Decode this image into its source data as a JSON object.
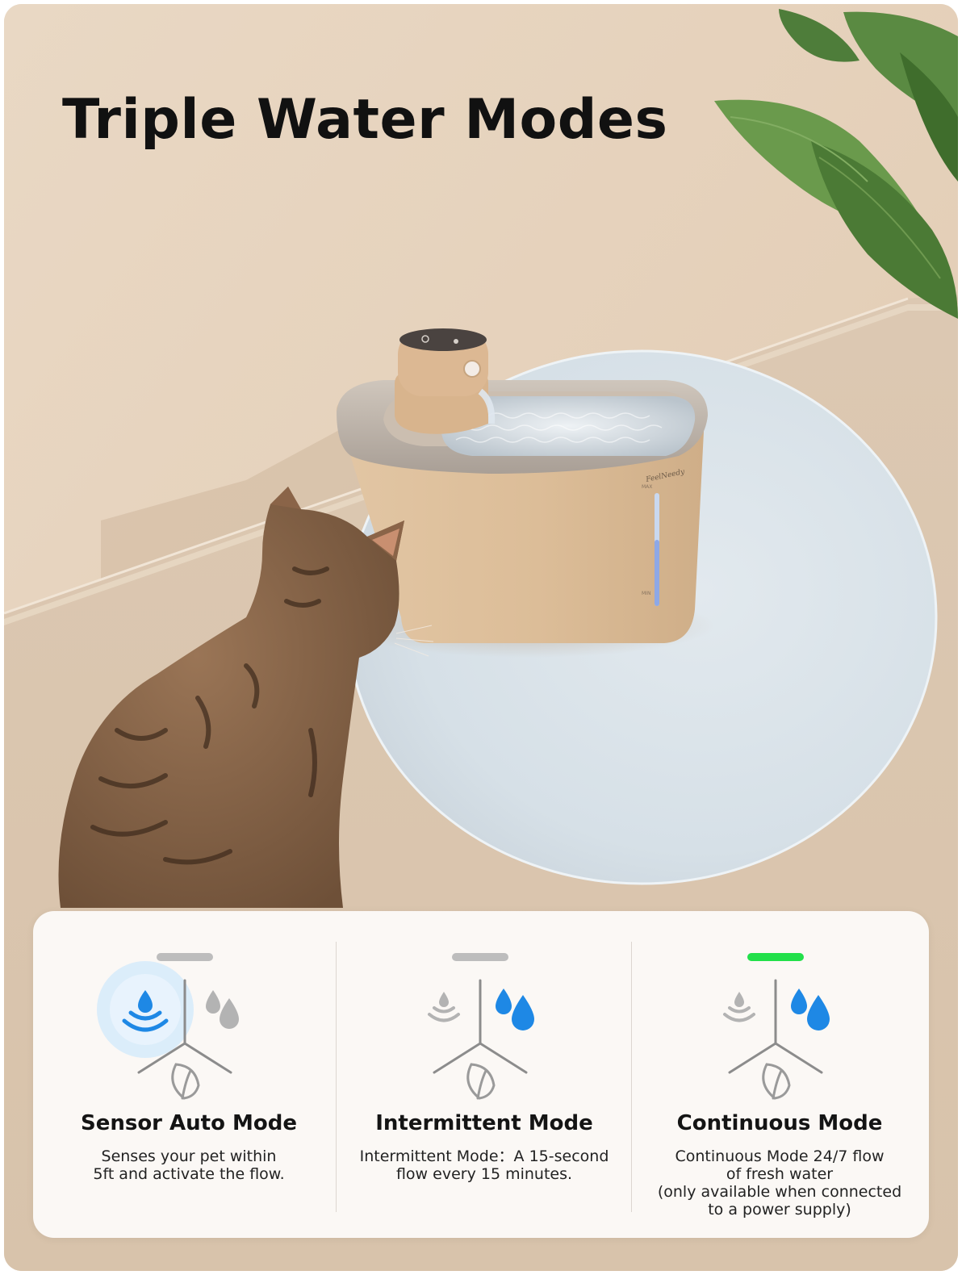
{
  "headline": "Triple Water Modes",
  "photo": {
    "brand_mark": "FeelNeedy",
    "level_max": "MAX",
    "level_min": "MIN"
  },
  "colors": {
    "indicator_inactive": "#bdbdbd",
    "indicator_active": "#22e04a",
    "drop_active": "#1e88e5",
    "drop_inactive": "#b3b3b3",
    "sensor_glow": "#d7ebfb"
  },
  "modes": [
    {
      "title": "Sensor Auto Mode",
      "description": "Senses your pet within\n5ft and activate the flow.",
      "indicator": "grey",
      "icons": [
        "sensor-wave-icon",
        "water-drops-icon",
        "leaf-icon"
      ]
    },
    {
      "title": "Intermittent Mode",
      "description": "Intermittent Mode：A 15-second\nflow every 15 minutes.",
      "indicator": "grey",
      "icons": [
        "sensor-wave-icon",
        "water-drops-icon",
        "leaf-icon"
      ]
    },
    {
      "title": "Continuous Mode",
      "description": "Continuous Mode 24/7 flow\nof fresh water\n(only available when connected\nto a power supply)",
      "indicator": "green",
      "icons": [
        "sensor-wave-icon",
        "water-drops-icon",
        "leaf-icon"
      ]
    }
  ]
}
